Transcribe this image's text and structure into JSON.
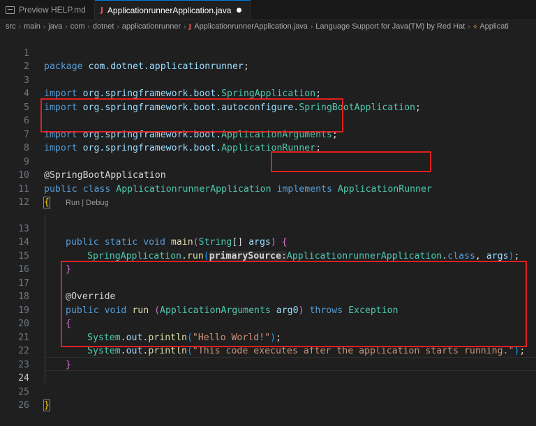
{
  "tabs": [
    {
      "label": "Preview HELP.md",
      "icon": "preview-icon",
      "active": false
    },
    {
      "label": "ApplicationrunnerApplication.java",
      "icon": "java-icon",
      "active": true,
      "dirty": true
    }
  ],
  "breadcrumb": {
    "items": [
      "src",
      "main",
      "java",
      "com",
      "dotnet",
      "applicationrunner",
      "ApplicationrunnerApplication.java",
      "Language Support for Java(TM) by Red Hat",
      "Applicati"
    ]
  },
  "codelens": "Run | Debug",
  "hint": {
    "name": "primarySource",
    "colon": ":"
  },
  "line_numbers": [
    "1",
    "2",
    "3",
    "4",
    "5",
    "6",
    "7",
    "8",
    "9",
    "10",
    "11",
    "12",
    "13",
    "14",
    "15",
    "16",
    "17",
    "18",
    "19",
    "20",
    "21",
    "22",
    "23",
    "24",
    "25",
    "26"
  ],
  "code": {
    "l1": {
      "kw": "package",
      "pkg": "com.dotnet.applicationrunner",
      "end": ";"
    },
    "l3": {
      "kw": "import",
      "pkg": "org.springframework.boot.",
      "cls": "SpringApplication",
      "end": ";"
    },
    "l4": {
      "kw": "import",
      "pkg": "org.springframework.boot.autoconfigure.",
      "cls": "SpringBootApplication",
      "end": ";"
    },
    "l6": {
      "kw": "import",
      "pkg": "org.springframework.boot.",
      "cls": "ApplicationArguments",
      "end": ";"
    },
    "l7": {
      "kw": "import",
      "pkg": "org.springframework.boot.",
      "cls": "ApplicationRunner",
      "end": ";"
    },
    "l9": {
      "anno": "@SpringBootApplication"
    },
    "l10": {
      "kw1": "public",
      "kw2": "class",
      "cls": "ApplicationrunnerApplication",
      "kw3": "implements",
      "iface": "ApplicationRunner"
    },
    "l11": {
      "brace": "{"
    },
    "l13": {
      "kw1": "public",
      "kw2": "static",
      "kw3": "void",
      "fn": "main",
      "open": "(",
      "type": "String",
      "arr": "[]",
      "var": "args",
      "close": ")",
      "brace": "{"
    },
    "l14": {
      "cls": "SpringApplication",
      "dot": ".",
      "fn": "run",
      "open": "(",
      "arg": "ApplicationrunnerApplication",
      "dot2": ".",
      "kw": "class",
      "comma": ", ",
      "var": "args",
      "close": ")",
      "end": ";"
    },
    "l15": {
      "brace": "}"
    },
    "l17": {
      "anno": "@Override"
    },
    "l18": {
      "kw1": "public",
      "kw2": "void",
      "fn": "run",
      "open": "(",
      "type": "ApplicationArguments",
      "var": "arg0",
      "close": ")",
      "kw3": "throws",
      "exc": "Exception"
    },
    "l19": {
      "brace": "{"
    },
    "l20": {
      "cls": "System",
      "dot1": ".",
      "field": "out",
      "dot2": ".",
      "fn": "println",
      "open": "(",
      "str": "\"Hello World!\"",
      "close": ")",
      "end": ";"
    },
    "l21": {
      "cls": "System",
      "dot1": ".",
      "field": "out",
      "dot2": ".",
      "fn": "println",
      "open": "(",
      "str": "\"This code executes after the application starts running.\"",
      "close": ")",
      "end": ";"
    },
    "l22": {
      "brace": "}"
    },
    "l25": {
      "brace": "}"
    }
  }
}
